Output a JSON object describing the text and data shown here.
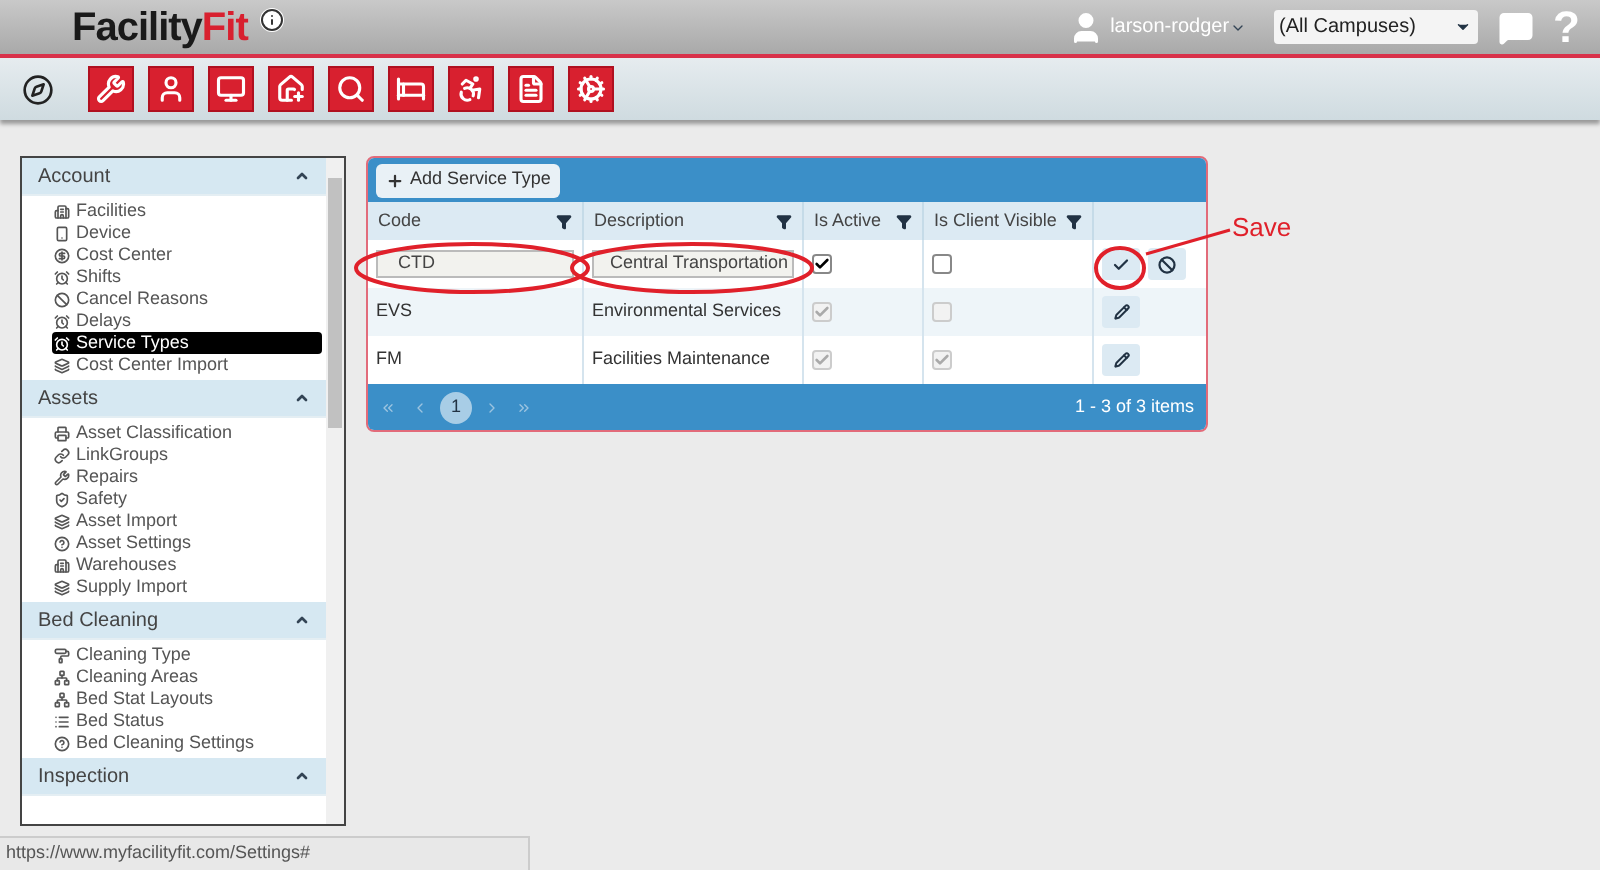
{
  "header": {
    "logo_dark": "Facility",
    "logo_red": "Fit",
    "user": "larson-rodger",
    "campus": "(All Campuses)",
    "help": "?"
  },
  "sidebar": {
    "sections": [
      {
        "title": "Account",
        "expanded": true,
        "items": [
          {
            "label": "Facilities",
            "kind": "building",
            "selected": false
          },
          {
            "label": "Device",
            "kind": "device",
            "selected": false
          },
          {
            "label": "Cost Center",
            "kind": "cost",
            "selected": false
          },
          {
            "label": "Shifts",
            "kind": "clock",
            "selected": false
          },
          {
            "label": "Cancel Reasons",
            "kind": "ban",
            "selected": false
          },
          {
            "label": "Delays",
            "kind": "clock",
            "selected": false
          },
          {
            "label": "Service Types",
            "kind": "clock",
            "selected": true
          },
          {
            "label": "Cost Center Import",
            "kind": "import",
            "selected": false
          }
        ]
      },
      {
        "title": "Assets",
        "expanded": true,
        "items": [
          {
            "label": "Asset Classification",
            "kind": "printer",
            "selected": false
          },
          {
            "label": "LinkGroups",
            "kind": "link",
            "selected": false
          },
          {
            "label": "Repairs",
            "kind": "wrench",
            "selected": false
          },
          {
            "label": "Safety",
            "kind": "safety",
            "selected": false
          },
          {
            "label": "Asset Import",
            "kind": "import",
            "selected": false
          },
          {
            "label": "Asset Settings",
            "kind": "help",
            "selected": false
          },
          {
            "label": "Warehouses",
            "kind": "building",
            "selected": false
          },
          {
            "label": "Supply Import",
            "kind": "import",
            "selected": false
          }
        ]
      },
      {
        "title": "Bed Cleaning",
        "expanded": true,
        "items": [
          {
            "label": "Cleaning Type",
            "kind": "roller",
            "selected": false
          },
          {
            "label": "Cleaning Areas",
            "kind": "network",
            "selected": false
          },
          {
            "label": "Bed Stat Layouts",
            "kind": "network",
            "selected": false
          },
          {
            "label": "Bed Status",
            "kind": "list",
            "selected": false
          },
          {
            "label": "Bed Cleaning Settings",
            "kind": "help",
            "selected": false
          }
        ]
      },
      {
        "title": "Inspection",
        "expanded": true
      }
    ]
  },
  "grid": {
    "add_button": "Add Service Type",
    "columns": [
      "Code",
      "Description",
      "Is Active",
      "Is Client Visible"
    ],
    "rows": [
      {
        "code": "CTD",
        "description": "Central Transportation",
        "is_active": true,
        "is_client_visible": false,
        "editing": true
      },
      {
        "code": "EVS",
        "description": "Environmental Services",
        "is_active": true,
        "is_client_visible": false,
        "editing": false
      },
      {
        "code": "FM",
        "description": "Facilities Maintenance",
        "is_active": true,
        "is_client_visible": true,
        "editing": false
      }
    ],
    "page": "1",
    "summary": "1 - 3 of 3 items"
  },
  "annotation": {
    "label": "Save"
  },
  "status_bar": {
    "url": "https://www.myfacilityfit.com/Settings#"
  }
}
